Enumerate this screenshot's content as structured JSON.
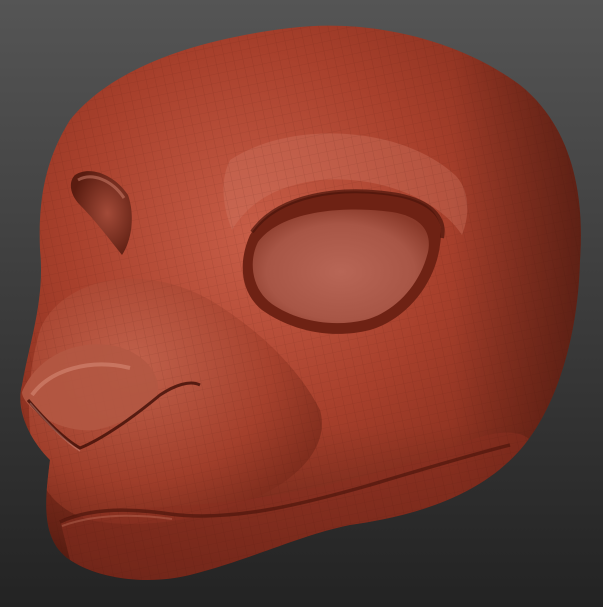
{
  "scene": {
    "subject": "sculpted-head-model",
    "material_color": "#a8402c",
    "highlight_color": "#d4806a",
    "shadow_color": "#5e1d12",
    "background_top": "#555555",
    "background_bottom": "#232323",
    "wireframe_visible": true
  }
}
